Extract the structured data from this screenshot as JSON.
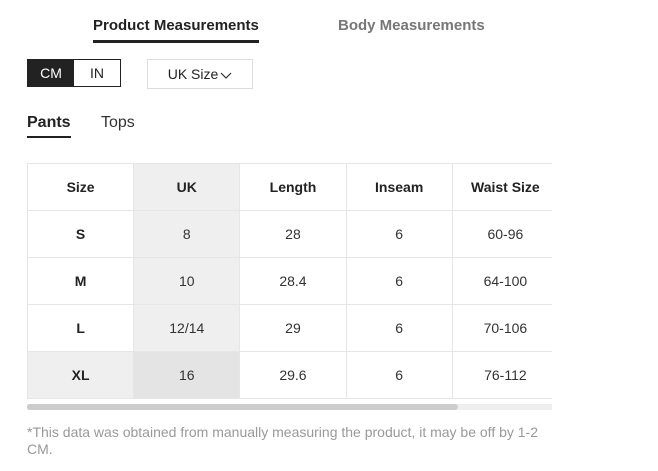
{
  "top_tabs": [
    {
      "label": "Product Measurements",
      "active": true
    },
    {
      "label": "Body Measurements",
      "active": false
    }
  ],
  "units": {
    "cm": "CM",
    "in": "IN",
    "selected": "CM"
  },
  "size_select": {
    "value": "UK Size"
  },
  "category_tabs": [
    {
      "label": "Pants",
      "active": true
    },
    {
      "label": "Tops",
      "active": false
    }
  ],
  "table": {
    "headers": [
      "Size",
      "UK",
      "Length",
      "Inseam",
      "Waist Size"
    ],
    "rows": [
      {
        "size": "S",
        "uk": "8",
        "length": "28",
        "inseam": "6",
        "waist": "60-96"
      },
      {
        "size": "M",
        "uk": "10",
        "length": "28.4",
        "inseam": "6",
        "waist": "64-100"
      },
      {
        "size": "L",
        "uk": "12/14",
        "length": "29",
        "inseam": "6",
        "waist": "70-106"
      },
      {
        "size": "XL",
        "uk": "16",
        "length": "29.6",
        "inseam": "6",
        "waist": "76-112"
      }
    ]
  },
  "footnote": "*This data was obtained from manually measuring the product, it may be off by 1-2 CM.",
  "colors": {
    "accent": "#222222",
    "highlight": "#efefef",
    "muted": "#999999"
  }
}
